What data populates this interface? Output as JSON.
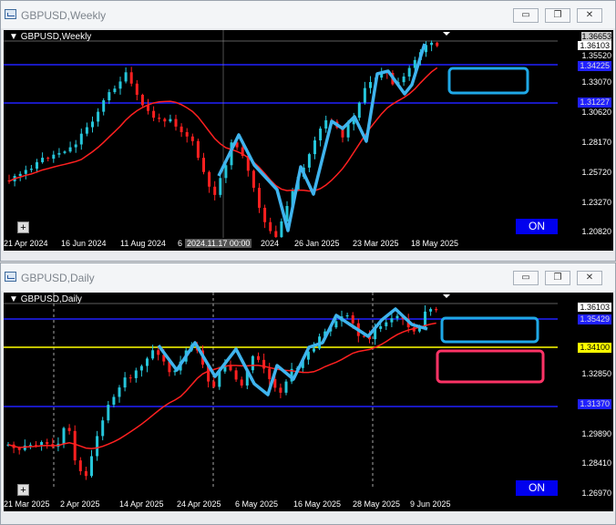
{
  "windows": [
    {
      "id": "weekly",
      "title": "GBPUSD,Weekly",
      "symbol_label": "GBPUSD,Weekly",
      "buttons": {
        "minimize": "▭",
        "restore": "❐",
        "close": "✕"
      },
      "price_labels": {
        "p1": "1.36653",
        "p2": "1.36103",
        "p3": "1.35520",
        "p4": "1.33070",
        "p5": "1.30620",
        "p6": "1.28170",
        "p7": "1.25720",
        "p8": "1.23270",
        "p9": "1.20820"
      },
      "box_labels": {
        "blue_top": "1.34225",
        "blue_bottom": "1.31227"
      },
      "x_ticks": [
        "21 Apr 2024",
        "16 Jun 2024",
        "11 Aug 2024",
        "6",
        "2024",
        "26 Jan 2025",
        "23 Mar 2025",
        "18 May 2025"
      ],
      "crosshair_label": "2024.11.17 00:00",
      "on_label": "ON",
      "plus_label": "+"
    },
    {
      "id": "daily",
      "title": "GBPUSD,Daily",
      "symbol_label": "GBPUSD,Daily",
      "buttons": {
        "minimize": "▭",
        "restore": "❐",
        "close": "✕"
      },
      "price_labels": {
        "p1": "1.36103",
        "p2": "1.34100",
        "p3": "1.32850",
        "p4": "1.29890",
        "p5": "1.28410",
        "p6": "1.26970"
      },
      "box_labels": {
        "blue_top": "1.35429",
        "yellow": "1.34100",
        "blue_bottom": "1.31370"
      },
      "x_ticks": [
        "21 Mar 2025",
        "2 Apr 2025",
        "14 Apr 2025",
        "24 Apr 2025",
        "6 May 2025",
        "16 May 2025",
        "28 May 2025",
        "9 Jun 2025"
      ],
      "on_label": "ON",
      "plus_label": "+"
    }
  ],
  "colors": {
    "bull": "#26c6da",
    "bear": "#ff2020",
    "ma": "#ff2020",
    "hline_blue": "#2020ff",
    "hline_yellow": "#ffff00",
    "zigzag": "#3fb4ee",
    "rect_cyan": "#1fa8e6",
    "rect_pink": "#ff3366"
  }
}
